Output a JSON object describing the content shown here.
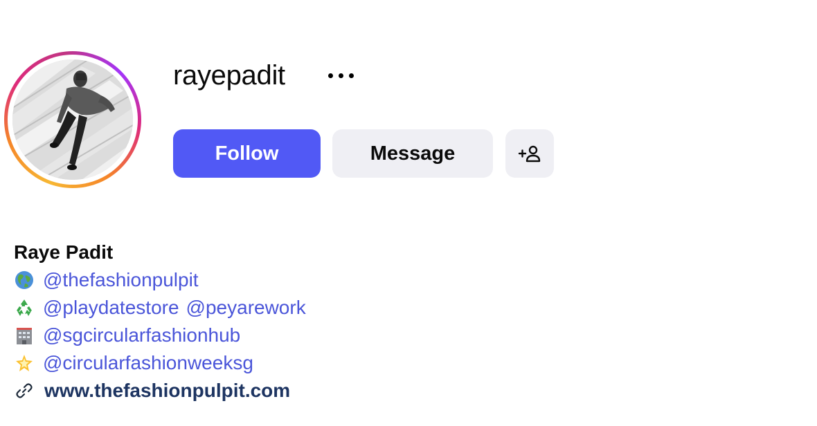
{
  "profile": {
    "username": "rayepadit",
    "full_name": "Raye Padit"
  },
  "actions": {
    "follow_label": "Follow",
    "message_label": "Message",
    "suggest_icon": "add-person-icon",
    "more_icon": "more-options-icon"
  },
  "bio": {
    "lines": [
      {
        "emoji": "globe-icon",
        "mentions": [
          "@thefashionpulpit"
        ]
      },
      {
        "emoji": "recycle-icon",
        "mentions": [
          "@playdatestore",
          "@peyarework"
        ]
      },
      {
        "emoji": "office-building-icon",
        "mentions": [
          "@sgcircularfashionhub"
        ]
      },
      {
        "emoji": "glowing-star-icon",
        "mentions": [
          "@circularfashionweeksg"
        ]
      }
    ],
    "website": "www.thefashionpulpit.com"
  },
  "colors": {
    "follow_button": "#5159f5",
    "secondary_button": "#efeff4",
    "mention_link": "#4a55d9",
    "website_link": "#1d3461"
  }
}
